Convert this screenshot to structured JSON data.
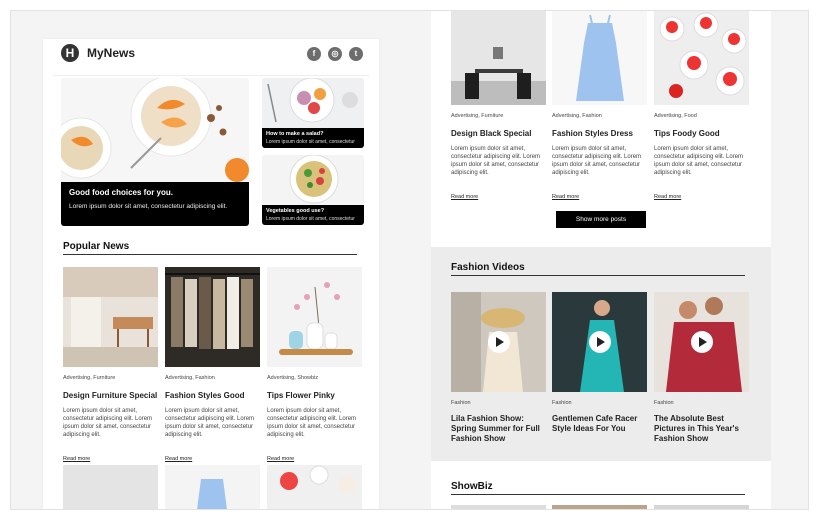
{
  "header": {
    "logo_letter": "H",
    "brand": "MyNews",
    "social": [
      {
        "name": "facebook-icon",
        "glyph": "f"
      },
      {
        "name": "instagram-icon",
        "glyph": "◎"
      },
      {
        "name": "twitter-icon",
        "glyph": "t"
      }
    ]
  },
  "hero": {
    "title": "Good food choices for you.",
    "text": "Lorem ipsum dolor sit amet, consectetur adipiscing elit."
  },
  "side_cards": [
    {
      "title": "How to make a salad?",
      "text": "Lorem ipsum dolor sit amet, consectetur"
    },
    {
      "title": "Vegetables good use?",
      "text": "Lorem ipsum dolor sit amet, consectetur"
    }
  ],
  "popular": {
    "title": "Popular News",
    "cards": [
      {
        "category": "Advertising, Furniture",
        "title": "Design Furniture Special",
        "text": "Lorem ipsum dolor sit amet, consectetur adipiscing elit. Lorem ipsum dolor sit amet, consectetur adipiscing elit.",
        "link": "Read more"
      },
      {
        "category": "Advertising, Fashion",
        "title": "Fashion Styles Good",
        "text": "Lorem ipsum dolor sit amet, consectetur adipiscing elit. Lorem ipsum dolor sit amet, consectetur adipiscing elit.",
        "link": "Read more"
      },
      {
        "category": "Advertising, Showbiz",
        "title": "Tips Flower Pinky",
        "text": "Lorem ipsum dolor sit amet, consectetur adipiscing elit. Lorem ipsum dolor sit amet, consectetur adipiscing elit.",
        "link": "Read more"
      }
    ]
  },
  "right_cards": [
    {
      "category": "Advertising, Furniture",
      "title": "Design Black Special",
      "text": "Lorem ipsum dolor sit amet, consectetur adipiscing elit. Lorem ipsum dolor sit amet, consectetur adipiscing elit.",
      "link": "Read more"
    },
    {
      "category": "Advertising, Fashion",
      "title": "Fashion Styles Dress",
      "text": "Lorem ipsum dolor sit amet, consectetur adipiscing elit. Lorem ipsum dolor sit amet, consectetur adipiscing elit.",
      "link": "Read more"
    },
    {
      "category": "Advertising, Food",
      "title": "Tips Foody Good",
      "text": "Lorem ipsum dolor sit amet, consectetur adipiscing elit. Lorem ipsum dolor sit amet, consectetur adipiscing elit.",
      "link": "Read more"
    }
  ],
  "show_more": "Show more posts",
  "videos": {
    "title": "Fashion Videos",
    "cards": [
      {
        "category": "Fashion",
        "title": "Lila Fashion Show: Spring Summer for Full Fashion Show"
      },
      {
        "category": "Fashion",
        "title": "Gentlemen Cafe Racer Style Ideas For You"
      },
      {
        "category": "Fashion",
        "title": "The Absolute Best Pictures in This Year's Fashion Show"
      }
    ]
  },
  "showbiz": {
    "title": "ShowBiz"
  }
}
